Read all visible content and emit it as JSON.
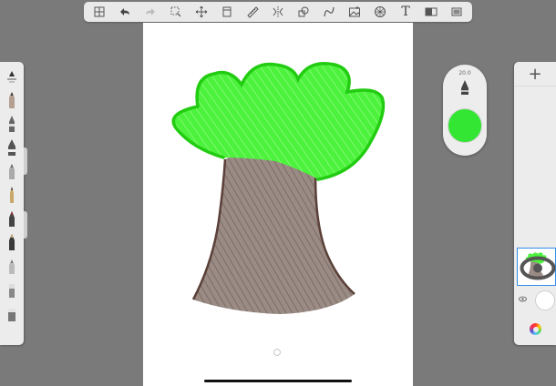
{
  "toolbar": {
    "items": [
      {
        "name": "gallery-icon",
        "label": ""
      },
      {
        "name": "undo-icon",
        "label": ""
      },
      {
        "name": "redo-icon",
        "label": ""
      },
      {
        "name": "selection-icon",
        "label": ""
      },
      {
        "name": "transform-icon",
        "label": ""
      },
      {
        "name": "crop-icon",
        "label": ""
      },
      {
        "name": "ruler-icon",
        "label": ""
      },
      {
        "name": "symmetry-icon",
        "label": ""
      },
      {
        "name": "shapes-icon",
        "label": ""
      },
      {
        "name": "curve-icon",
        "label": ""
      },
      {
        "name": "image-icon",
        "label": ""
      },
      {
        "name": "perspective-icon",
        "label": ""
      },
      {
        "name": "text-icon",
        "label": "T"
      },
      {
        "name": "layer-toggle-icon",
        "label": ""
      },
      {
        "name": "fullscreen-icon",
        "label": ""
      }
    ]
  },
  "puck": {
    "brush_size": "20.0",
    "color": "#33e633"
  },
  "layers": {
    "add_label": "+"
  },
  "colors": {
    "canopy": "#44ee33",
    "canopy_outline": "#22cc11",
    "trunk": "#8c7c74",
    "trunk_outline": "#5a4038",
    "selection": "#2f8fe8"
  }
}
